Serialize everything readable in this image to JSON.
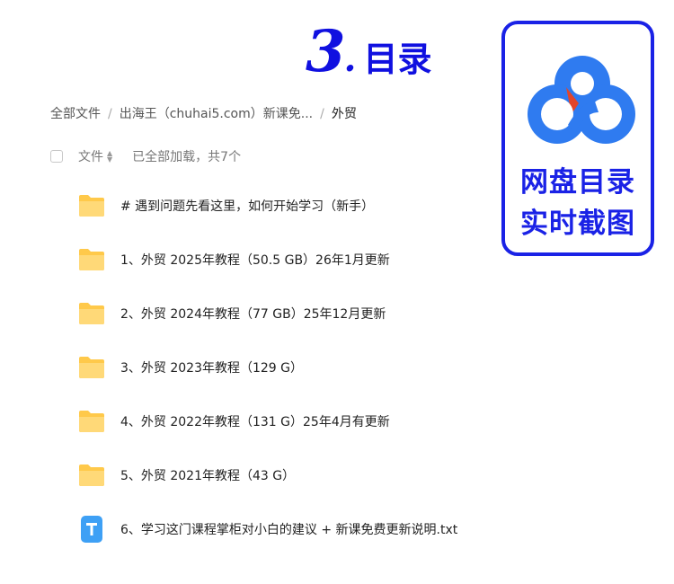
{
  "heading": {
    "number": "3",
    "dot": ".",
    "text": "目录"
  },
  "badge": {
    "line1": "网盘目录",
    "line2": "实时截图",
    "colors": {
      "border": "#1a22e6",
      "cloud_blue": "#2f7bf0",
      "cloud_red": "#e2452a"
    },
    "icon": "baidu-netdisk-cloud-icon"
  },
  "breadcrumb": [
    {
      "label": "全部文件"
    },
    {
      "label": "出海王（chuhai5.com）新课免..."
    },
    {
      "label": "外贸"
    }
  ],
  "breadcrumb_sep": "/",
  "list_header": {
    "name_col": "文件",
    "loaded_text": "已全部加载，共7个",
    "sort_icon": "sort-arrows-icon"
  },
  "files": [
    {
      "name": "# 遇到问题先看这里，如何开始学习（新手）",
      "type": "folder"
    },
    {
      "name": "1、外贸 2025年教程（50.5 GB）26年1月更新",
      "type": "folder"
    },
    {
      "name": "2、外贸 2024年教程（77 GB）25年12月更新",
      "type": "folder"
    },
    {
      "name": "3、外贸 2023年教程（129 G）",
      "type": "folder"
    },
    {
      "name": "4、外贸 2022年教程（131 G）25年4月有更新",
      "type": "folder"
    },
    {
      "name": "5、外贸 2021年教程（43 G）",
      "type": "folder"
    },
    {
      "name": "6、学习这门课程掌柜对小白的建议 + 新课免费更新说明.txt",
      "type": "txt"
    }
  ],
  "colors": {
    "folder": "#ffd46b",
    "txt_icon": "#3ea0f5",
    "heading": "#1010e0"
  }
}
